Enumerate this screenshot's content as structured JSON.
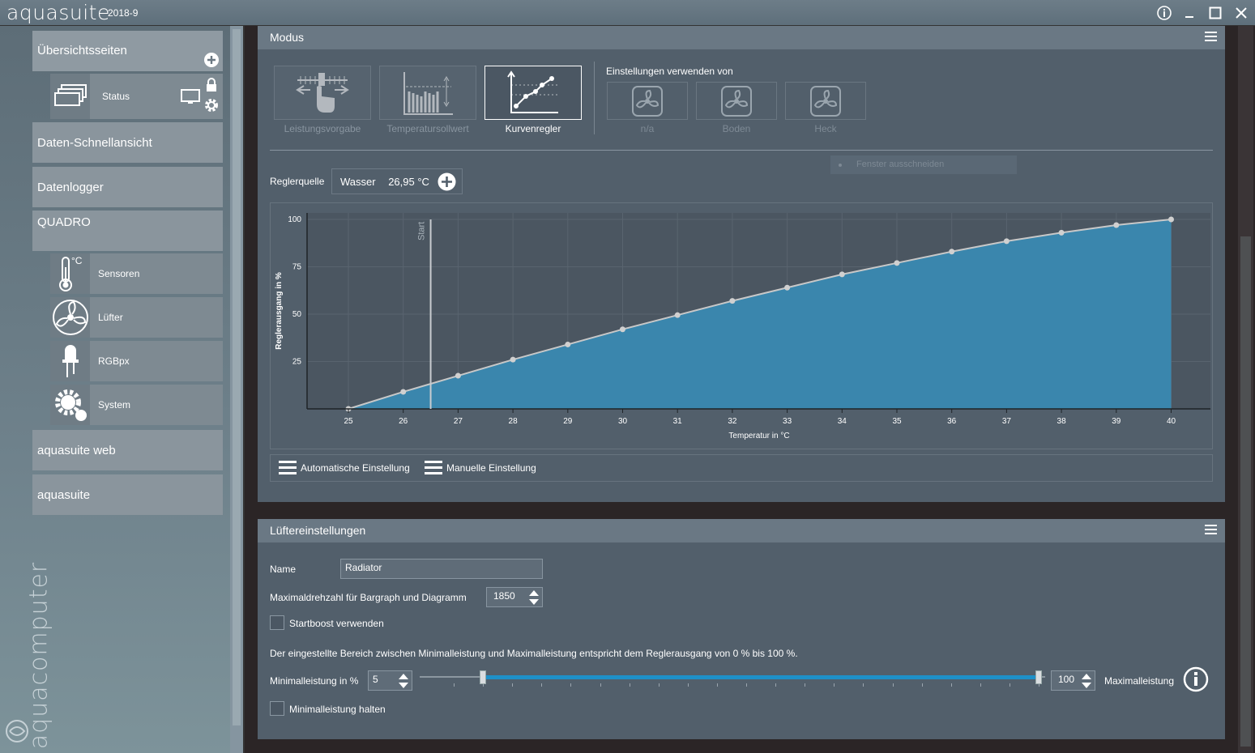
{
  "app": {
    "title": "aquasuite",
    "version": "2018-9",
    "vendor_logo": "aquacomputer"
  },
  "sidebar": {
    "overview": "Übersichtsseiten",
    "status": "Status",
    "quick_view": "Daten-Schnellansicht",
    "datalogger": "Datenlogger",
    "device": "QUADRO",
    "sub_items": [
      "Sensoren",
      "Lüfter",
      "RGBpx",
      "System"
    ],
    "web": "aquasuite web",
    "suite": "aquasuite",
    "celsius": "°C"
  },
  "mode_panel": {
    "title": "Modus",
    "modes": [
      "Leistungsvorgabe",
      "Temperatursollwert",
      "Kurvenregler"
    ],
    "active_mode": "Kurvenregler",
    "use_settings_label": "Einstellungen verwenden von",
    "sources": [
      "n/a",
      "Boden",
      "Heck"
    ],
    "tooltip": "Fenster ausschneiden",
    "controller_source_label": "Reglerquelle",
    "controller_source_name": "Wasser",
    "controller_source_value": "26,95 °C",
    "auto_label": "Automatische Einstellung",
    "manual_label": "Manuelle Einstellung"
  },
  "chart_data": {
    "type": "area",
    "xlabel": "Temperatur in °C",
    "ylabel": "Reglerausgang in %",
    "xlim": [
      25,
      40
    ],
    "ylim": [
      0,
      100
    ],
    "x_ticks": [
      "25",
      "26",
      "27",
      "28",
      "29",
      "30",
      "31",
      "32",
      "33",
      "34",
      "35",
      "36",
      "37",
      "38",
      "39",
      "40"
    ],
    "y_ticks": [
      "25",
      "50",
      "75",
      "100"
    ],
    "start_marker": {
      "x": 26.5,
      "label": "Start"
    },
    "grid": true,
    "x": [
      25,
      26,
      27,
      28,
      29,
      30,
      31,
      32,
      33,
      34,
      35,
      36,
      37,
      38,
      39,
      40
    ],
    "y": [
      0,
      9,
      17.5,
      26,
      34,
      42,
      49.5,
      57,
      64,
      71,
      77,
      83,
      88.5,
      93,
      97,
      100
    ],
    "fill_color": "#3a86ad",
    "line_color": "#c8c8c8"
  },
  "fan_panel": {
    "title": "Lüftereinstellungen",
    "name_label": "Name",
    "name_value": "Radiator",
    "maxrpm_label": "Maximaldrehzahl für Bargraph und Diagramm",
    "maxrpm_value": "1850",
    "startboost_label": "Startboost verwenden",
    "range_text": "Der eingestellte Bereich zwischen Minimalleistung und Maximalleistung entspricht dem Reglerausgang von 0 % bis 100 %.",
    "min_label": "Minimalleistung in %",
    "min_value": "5",
    "max_value": "100",
    "max_label": "Maximalleistung",
    "hold_min_label": "Minimalleistung halten",
    "slider_min": 5,
    "slider_max": 100
  }
}
